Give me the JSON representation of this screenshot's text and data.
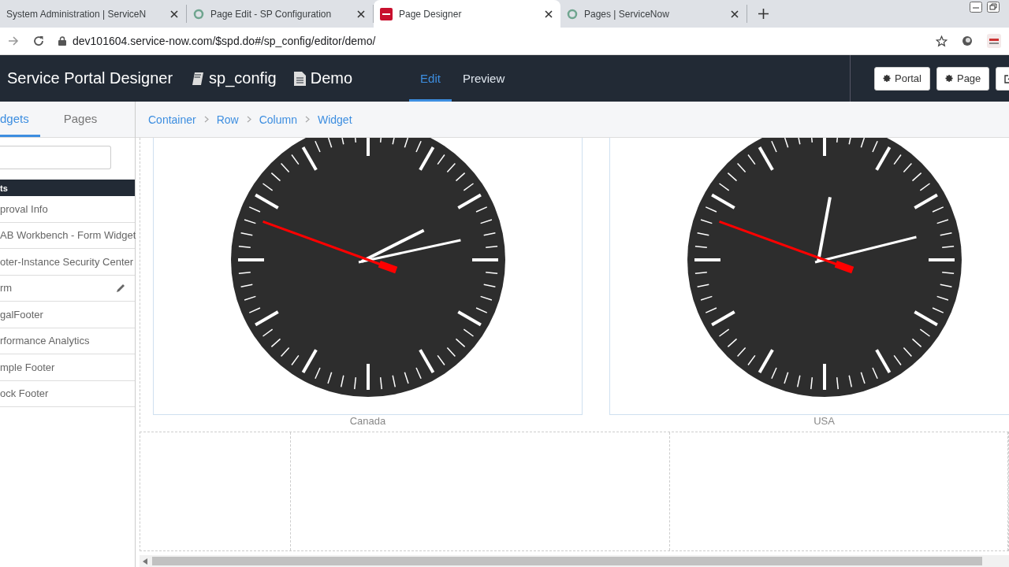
{
  "browser": {
    "tabs": [
      {
        "title": "System Administration | ServiceN",
        "kind": "plain",
        "selected": false
      },
      {
        "title": "Page Edit - SP Configuration",
        "kind": "portal",
        "selected": false
      },
      {
        "title": "Page Designer",
        "kind": "instance",
        "selected": true
      },
      {
        "title": "Pages | ServiceNow",
        "kind": "portal",
        "selected": false
      }
    ],
    "url": "dev101604.service-now.com/$spd.do#/sp_config/editor/demo/"
  },
  "header": {
    "title": "Service Portal Designer",
    "portal": "sp_config",
    "page": "Demo",
    "modes": [
      {
        "label": "Edit",
        "selected": true
      },
      {
        "label": "Preview",
        "selected": false
      }
    ],
    "buttons": [
      {
        "label": "Portal"
      },
      {
        "label": "Page"
      }
    ]
  },
  "sidebar": {
    "tabs": [
      {
        "label": "dgets",
        "selected": true
      },
      {
        "label": "Pages",
        "selected": false
      }
    ],
    "section": "ts",
    "items": [
      {
        "label": "proval Info",
        "edit": false
      },
      {
        "label": "AB Workbench - Form Widget",
        "edit": false
      },
      {
        "label": "oter-Instance Security Center",
        "edit": false
      },
      {
        "label": "rm",
        "edit": true
      },
      {
        "label": "galFooter",
        "edit": false
      },
      {
        "label": "rformance Analytics",
        "edit": false
      },
      {
        "label": "mple Footer",
        "edit": false
      },
      {
        "label": "ock Footer",
        "edit": false
      }
    ]
  },
  "breadcrumb": [
    "Container",
    "Row",
    "Column",
    "Widget"
  ],
  "clocks": [
    {
      "label": "Canada"
    },
    {
      "label": "USA"
    }
  ]
}
